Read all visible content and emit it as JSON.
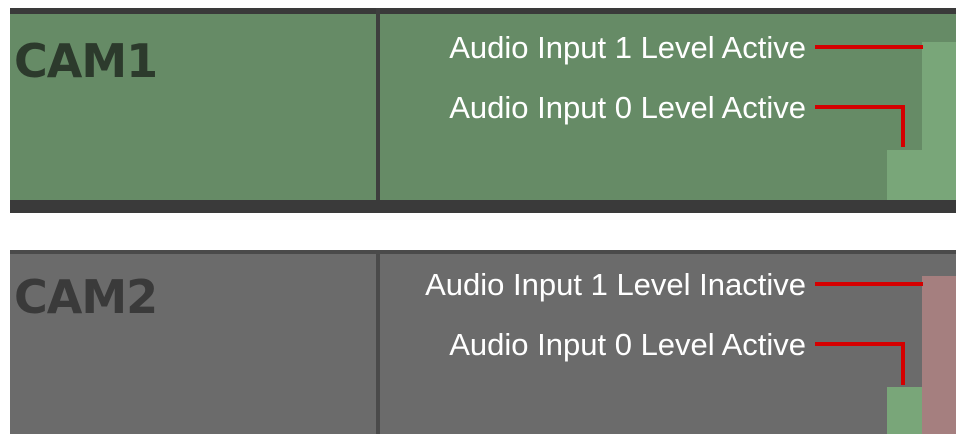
{
  "panels": [
    {
      "camera": "CAM1",
      "background": "#668b66",
      "annotations": [
        {
          "text": "Audio Input 1 Level Active"
        },
        {
          "text": "Audio Input 0 Level Active"
        }
      ],
      "levels": [
        {
          "input": 1,
          "state": "active",
          "color": "#79a679"
        },
        {
          "input": 0,
          "state": "active",
          "color": "#79a679"
        }
      ]
    },
    {
      "camera": "CAM2",
      "background": "#6b6b6b",
      "annotations": [
        {
          "text": "Audio Input 1 Level Inactive"
        },
        {
          "text": "Audio Input 0 Level Active"
        }
      ],
      "levels": [
        {
          "input": 1,
          "state": "inactive",
          "color": "#a57f7f"
        },
        {
          "input": 0,
          "state": "active",
          "color": "#79a679"
        }
      ]
    }
  ],
  "leader_line_color": "#d40000"
}
